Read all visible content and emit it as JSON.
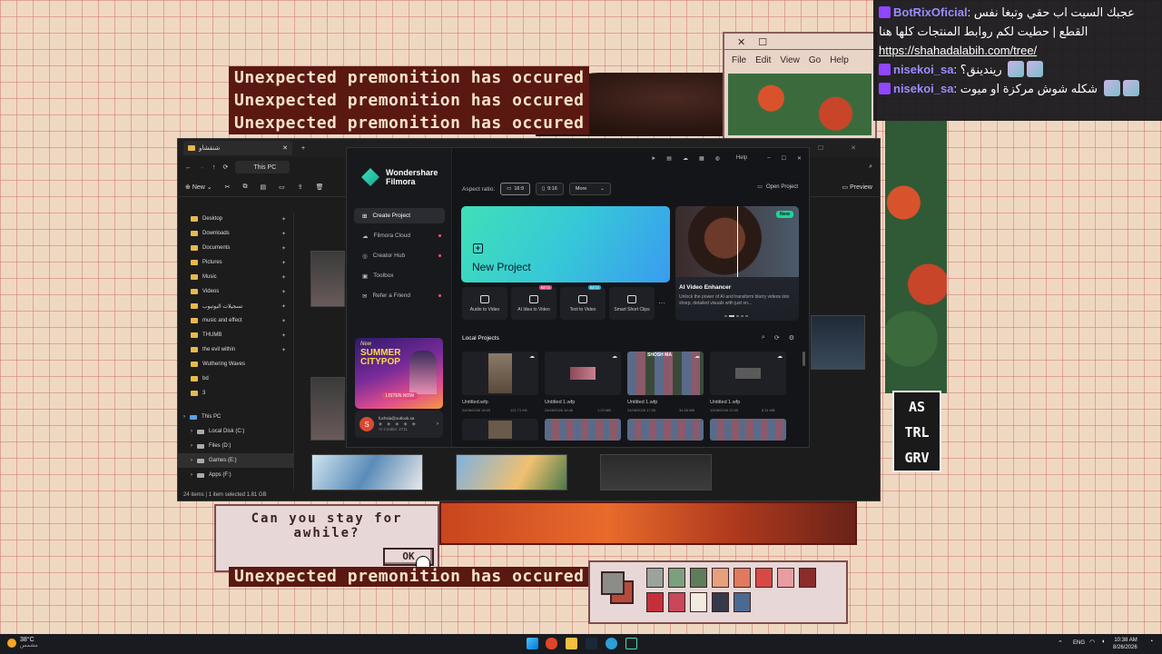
{
  "wallpaper": {
    "banner_lines": [
      "Unexpected premonition has occured",
      "Unexpected premonition has occured",
      "Unexpected premonition has occured"
    ],
    "bottom_banner": "Unexpected premonition has occured",
    "dialog_text": "Can you stay for awhile?",
    "dialog_ok": "OK",
    "retro_menu": [
      "File",
      "Edit",
      "View",
      "Go",
      "Help"
    ],
    "sign_text": "AS TRL GRV",
    "palette_colors": [
      "#9aa39c",
      "#7c9f7e",
      "#5e7d5b",
      "#e5a07e",
      "#e07a5d",
      "#d64a45",
      "#e79da0",
      "#8a2c2c",
      "#c4303a",
      "#c7485a",
      "#f2ebe1",
      "#343a4a",
      "#4b6a92"
    ]
  },
  "chat": {
    "messages": [
      {
        "user": "BotRixOficial",
        "text": "عجبك السيت اب حقي وتبغا نفس القطع | حطيت لكم روابط المنتجات كلها هنا",
        "link": "https://shahadalabih.com/tree/"
      },
      {
        "user": "nisekoi_sa",
        "text": "ريندينق؟"
      },
      {
        "user": "nisekoi_sa",
        "text": "شكله شوش مركزة او ميوت"
      }
    ]
  },
  "explorer": {
    "tab_title": "شنقشاو",
    "address": "This PC",
    "new_label": "New",
    "preview_label": "Preview",
    "quick_access": [
      {
        "label": "Desktop",
        "icon": "desktop-icon"
      },
      {
        "label": "Downloads",
        "icon": "download-icon"
      },
      {
        "label": "Documents",
        "icon": "document-icon"
      },
      {
        "label": "Pictures",
        "icon": "picture-icon"
      },
      {
        "label": "Music",
        "icon": "music-icon"
      },
      {
        "label": "Videos",
        "icon": "video-icon"
      },
      {
        "label": "تسجيلات اليوتيوب",
        "icon": "folder-icon"
      },
      {
        "label": "music and effect",
        "icon": "folder-icon"
      },
      {
        "label": "THUMB",
        "icon": "folder-icon"
      },
      {
        "label": "the evil within",
        "icon": "folder-icon"
      },
      {
        "label": "Wuthering Waves",
        "icon": "folder-icon"
      },
      {
        "label": "bd",
        "icon": "folder-icon"
      },
      {
        "label": "3",
        "icon": "folder-icon"
      }
    ],
    "this_pc": "This PC",
    "drives": [
      "Local Disk (C:)",
      "Files (D:)",
      "Games (E:)",
      "Apps (F:)"
    ],
    "status": "24 items   |   1 item selected  1.81 GB"
  },
  "filmora": {
    "brand_line1": "Wondershare",
    "brand_line2": "Filmora",
    "help": "Help",
    "nav": [
      "Create Project",
      "Filmora Cloud",
      "Creator Hub",
      "Toolbox",
      "Refer a Friend"
    ],
    "promo_title": "SUMMER CITYPOP",
    "promo_top": "New",
    "promo_cta": "LISTEN NOW",
    "user_email": "fuchsia@outlook.sa",
    "user_credits": "AI Credits: 2711",
    "user_initial": "S",
    "aspect_label": "Aspect ratio:",
    "aspect_options": [
      "16:9",
      "9:16",
      "More"
    ],
    "open_project": "Open Project",
    "new_project": "New Project",
    "ai_badge": "New",
    "ai_title": "AI Video Enhancer",
    "ai_desc": "Unlock the power of AI and transform blurry videos into sharp, detailed visuals with just on...",
    "tools": [
      {
        "label": "Audio to Video",
        "beta": ""
      },
      {
        "label": "AI Idea to Video",
        "beta": "BETA"
      },
      {
        "label": "Text to Video",
        "beta": "BETA"
      },
      {
        "label": "Smart Short Clips",
        "beta": ""
      }
    ],
    "local_projects": "Local Projects",
    "projects": [
      {
        "title": "Untitled.wfp",
        "date": "24/08/2026 18:09",
        "size": "121.71 KB"
      },
      {
        "title": "Untitled 1.wfp",
        "date": "24/08/2026 16:46",
        "size": "1.23 MB"
      },
      {
        "title": "Untitled 1.wfp",
        "date": "24/08/2026 17:39",
        "size": "34.55 MB"
      },
      {
        "title": "Untitled 1.wfp",
        "date": "10/08/2026 22:05",
        "size": "8.11 MB"
      }
    ],
    "grid_label": "SHOSH MA"
  },
  "taskbar": {
    "weather_temp": "38°C",
    "weather_desc": "مشمس",
    "lang": "ENG",
    "time": "10:38 AM",
    "date": "8/26/2026"
  }
}
